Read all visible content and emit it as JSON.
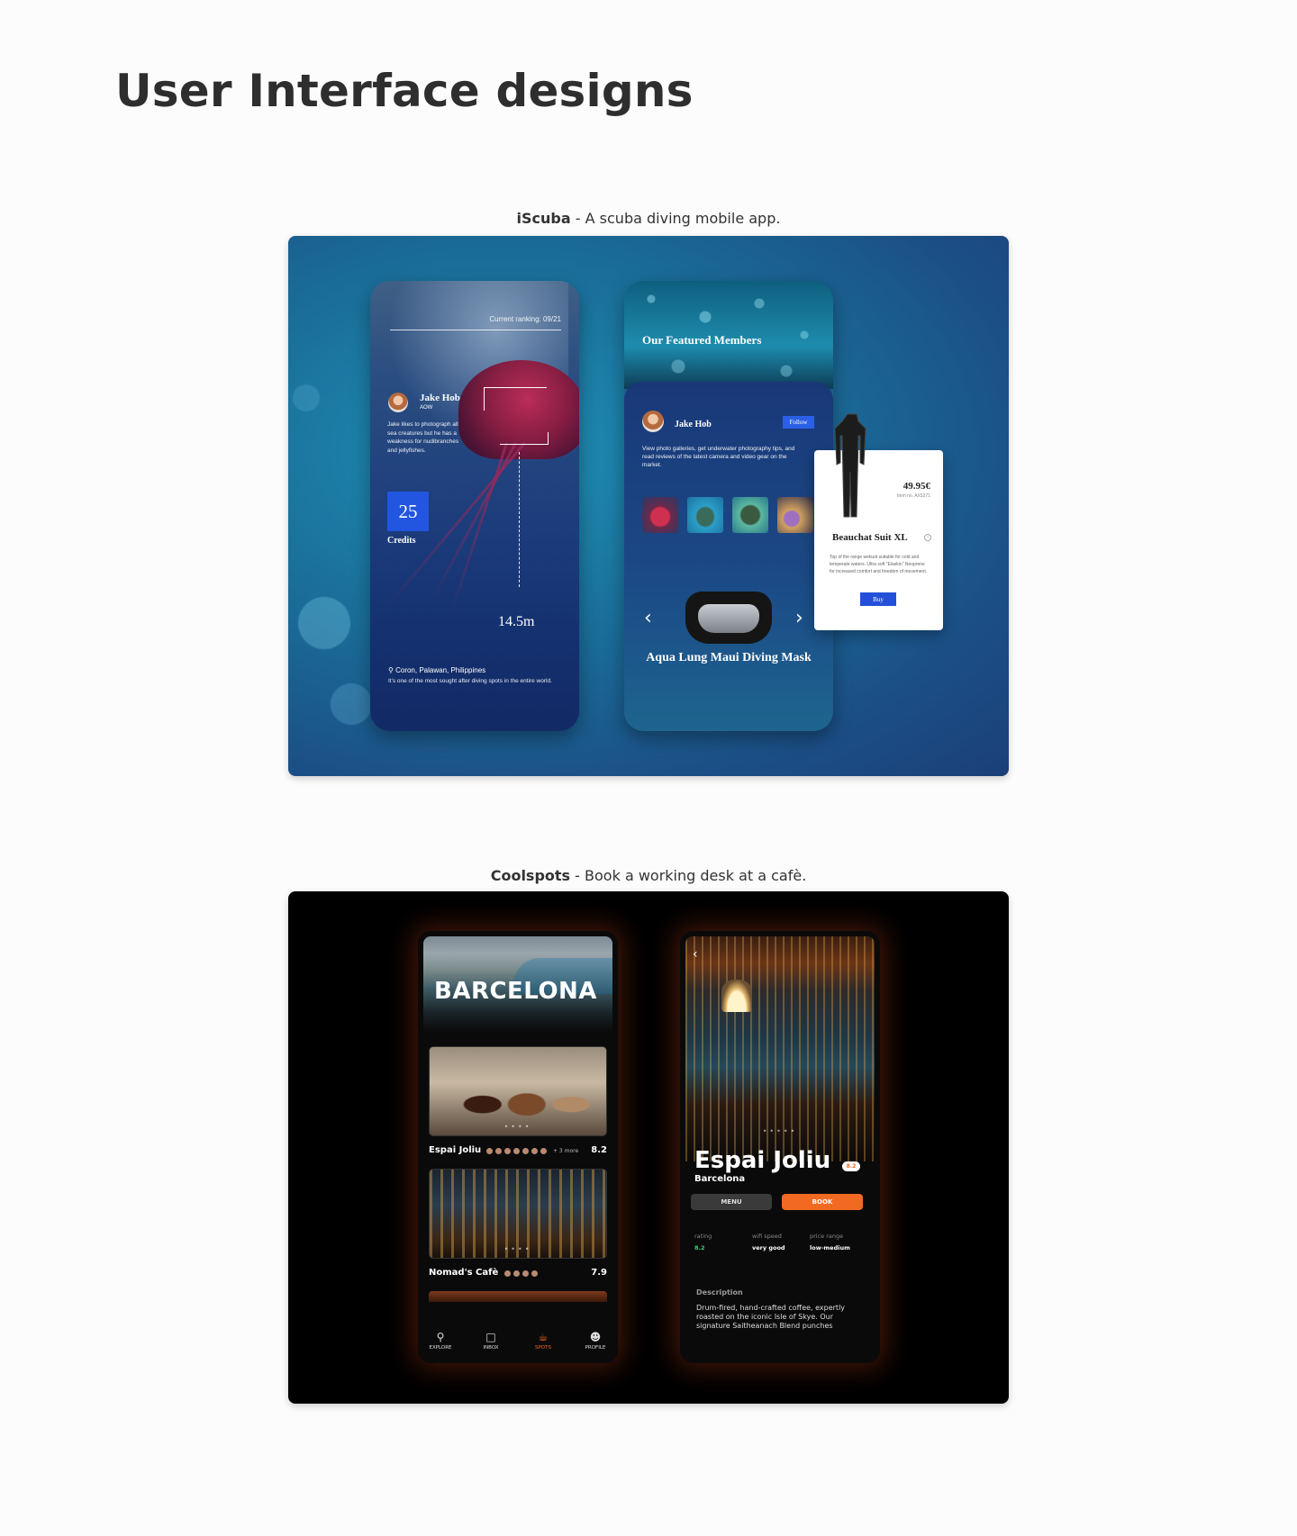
{
  "page": {
    "title": "User Interface designs"
  },
  "projects": [
    {
      "name": "iScuba",
      "separator": " - ",
      "tagline": "A scuba diving mobile app."
    },
    {
      "name": "Coolspots",
      "separator": " - ",
      "tagline": "Book a working desk at a cafè."
    }
  ],
  "iscuba": {
    "profile_screen": {
      "ranking": "Current ranking: 09/21",
      "user_name": "Jake Hob",
      "user_level": "AOW",
      "bio": "Jake likes to photograph all sea creatures but he has a weakness for nudibranches and jellyfishes.",
      "credits_value": "25",
      "credits_label": "Credits",
      "depth": "14.5m",
      "location": "Coron, Palawan, Philippines",
      "location_desc": "It's one of the most sought after diving spots in the entire world."
    },
    "members_screen": {
      "title": "Our Featured Members",
      "member_name": "Jake Hob",
      "follow_label": "Follow",
      "description": "View photo galleries, get underwater photography tips, and read reviews of the latest camera and video gear on the market.",
      "prev_icon": "chevron-left-icon",
      "next_icon": "chevron-right-icon",
      "product_name": "Aqua Lung Maui Diving Mask"
    },
    "product_card": {
      "price": "49.95€",
      "item_no": "Item no. AX5271",
      "name": "Beauchat Suit XL",
      "description": "Top of the range wetsuit suitable for cold and temperate waters. Ultra soft \"Elaskin\" Neoprene for increased comfort and freedom of movement.",
      "buy_label": "Buy"
    }
  },
  "coolspots": {
    "list_screen": {
      "city": "BARCELONA",
      "spots": [
        {
          "name": "Espai Joliu",
          "score": "8.2",
          "more": "+ 3 more"
        },
        {
          "name": "Nomad's Cafè",
          "score": "7.9",
          "more": ""
        }
      ],
      "nav": [
        {
          "label": "EXPLORE",
          "icon": "search-icon"
        },
        {
          "label": "INBOX",
          "icon": "chat-icon"
        },
        {
          "label": "SPOTS",
          "icon": "cup-icon"
        },
        {
          "label": "PROFILE",
          "icon": "user-icon"
        }
      ],
      "active_nav": "SPOTS",
      "accent": "#f26a22"
    },
    "detail_screen": {
      "name": "Espai Joliu",
      "badge": "8.2",
      "city": "Barcelona",
      "menu_label": "MENU",
      "book_label": "BOOK",
      "stats": [
        {
          "key": "rating",
          "value": "8.2"
        },
        {
          "key": "wifi speed",
          "value": "very good"
        },
        {
          "key": "price range",
          "value": "low-medium"
        }
      ],
      "description_heading": "Description",
      "description": "Drum-fired, hand-crafted coffee, expertly roasted on the iconic Isle of Skye. Our signature Saitheanach Blend punches"
    }
  }
}
